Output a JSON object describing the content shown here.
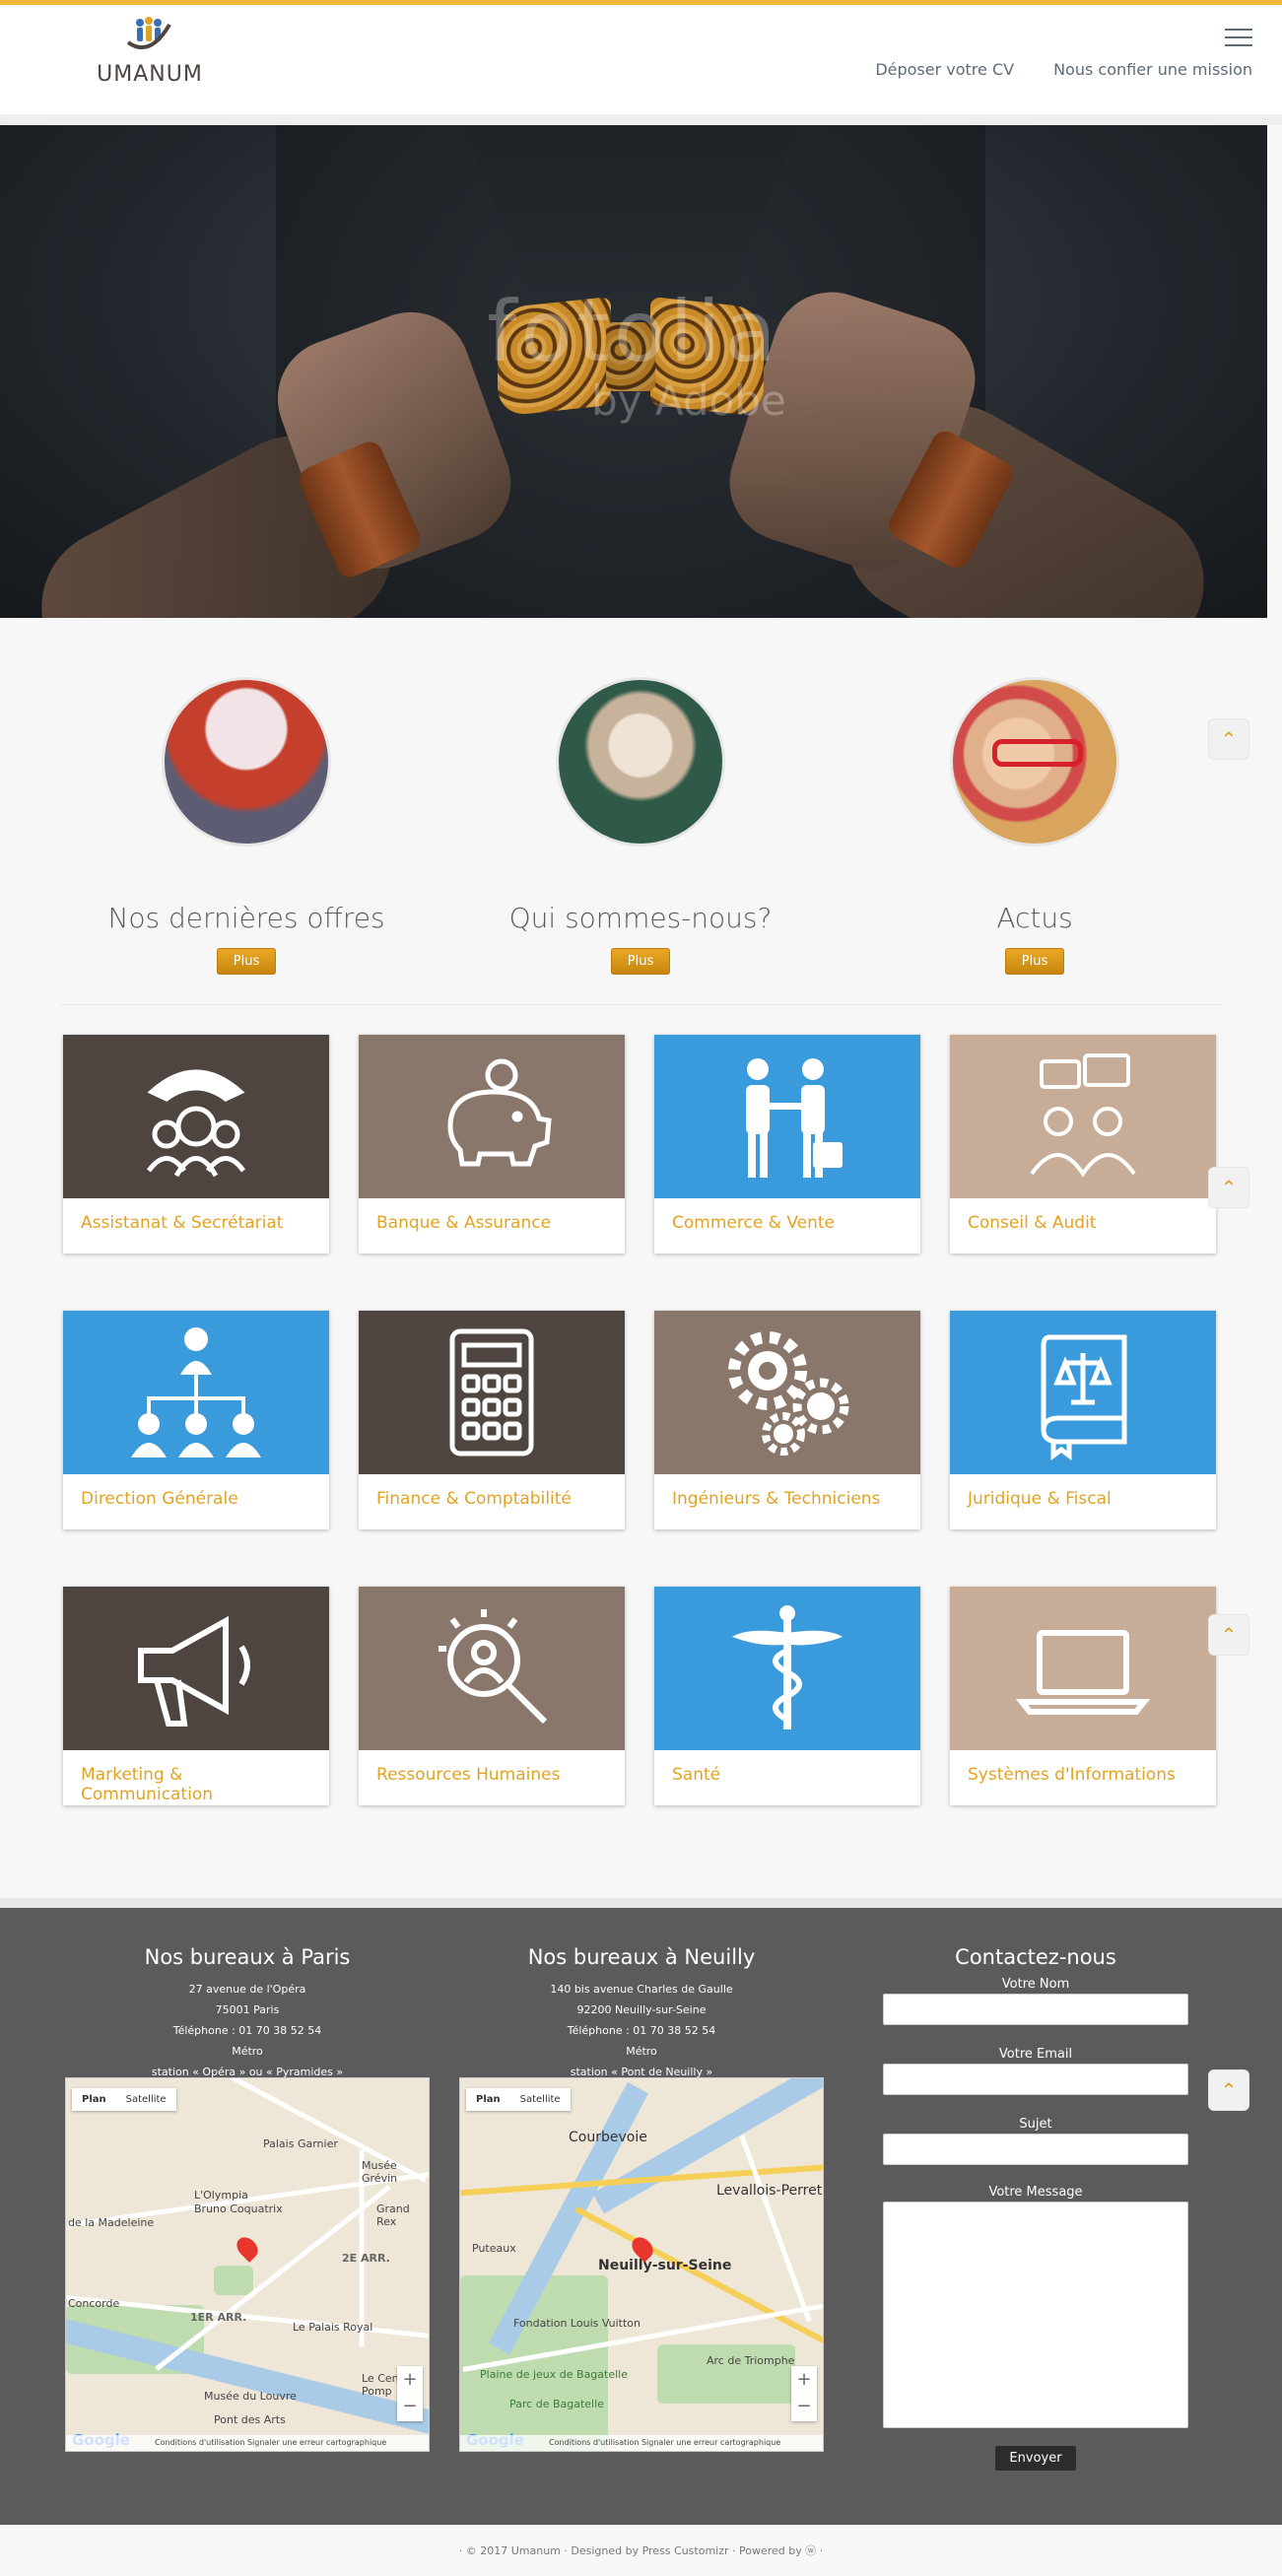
{
  "header": {
    "logo_text": "UMANUM",
    "nav": [
      "Déposer votre CV",
      "Nous confier une mission"
    ]
  },
  "hero": {
    "watermark": "fotolia",
    "watermark_sub": "by Adobe"
  },
  "features": [
    {
      "title": "Nos dernières offres",
      "button": "Plus"
    },
    {
      "title": "Qui sommes-nous?",
      "button": "Plus"
    },
    {
      "title": "Actus",
      "button": "Plus"
    }
  ],
  "sectors": [
    {
      "label": "Assistanat & Secrétariat",
      "icon": "telephone-icon",
      "color": "#4e4440"
    },
    {
      "label": "Banque & Assurance",
      "icon": "piggy-bank-icon",
      "color": "#8a776c"
    },
    {
      "label": "Commerce & Vente",
      "icon": "handshake-icon",
      "color": "#3a9bdc"
    },
    {
      "label": "Conseil & Audit",
      "icon": "consulting-icon",
      "color": "#c7ad98"
    },
    {
      "label": "Direction Générale",
      "icon": "org-chart-icon",
      "color": "#3a9bdc"
    },
    {
      "label": "Finance & Comptabilité",
      "icon": "calculator-icon",
      "color": "#4e4440"
    },
    {
      "label": "Ingénieurs & Techniciens",
      "icon": "gears-icon",
      "color": "#8a776c"
    },
    {
      "label": "Juridique & Fiscal",
      "icon": "law-book-icon",
      "color": "#3a9bdc"
    },
    {
      "label": "Marketing & Communication",
      "icon": "megaphone-icon",
      "color": "#4e4440"
    },
    {
      "label": "Ressources Humaines",
      "icon": "magnifier-person-icon",
      "color": "#8a776c"
    },
    {
      "label": "Santé",
      "icon": "caduceus-icon",
      "color": "#3a9bdc"
    },
    {
      "label": "Systèmes d'Informations",
      "icon": "laptop-icon",
      "color": "#c7ad98"
    }
  ],
  "footer": {
    "paris": {
      "title": "Nos bureaux à Paris",
      "lines": [
        "27 avenue de l'Opéra",
        "75001 Paris",
        "Téléphone : 01 70 38 52 54",
        "Métro",
        "station « Opéra » ou « Pyramides »"
      ],
      "map_labels": [
        "Palais Garnier",
        "Musée Grévin",
        "L'Olympia",
        "Bruno Coquatrix",
        "2E ARR.",
        "1ER ARR.",
        "Le Palais Royal",
        "Le Centre Pomp",
        "Musée du Louvre",
        "Pont des Arts",
        "Concorde",
        "de la Madeleine",
        "Grand Rex"
      ]
    },
    "neuilly": {
      "title": "Nos bureaux à Neuilly",
      "lines": [
        "140 bis avenue Charles de Gaulle",
        "92200 Neuilly-sur-Seine",
        "Téléphone : 01 70 38 52 54",
        "Métro",
        "station « Pont de Neuilly »"
      ],
      "map_labels": [
        "Courbevoie",
        "Levallois-Perret",
        "Puteaux",
        "Neuilly-sur-Seine",
        "Fondation Louis Vuitton",
        "Arc de Triomphe",
        "Plaine de jeux de Bagatelle",
        "Parc de Bagatelle"
      ]
    },
    "map_tabs": [
      "Plan",
      "Satellite"
    ],
    "map_footer": "Conditions d'utilisation   Signaler une erreur cartographique",
    "contact": {
      "title": "Contactez-nous",
      "name": "Votre Nom",
      "email": "Votre Email",
      "subject": "Sujet",
      "message": "Votre Message",
      "send": "Envoyer"
    }
  },
  "copyright": "· © 2017 Umanum · Designed by Press Customizr · Powered by ⓦ ·"
}
